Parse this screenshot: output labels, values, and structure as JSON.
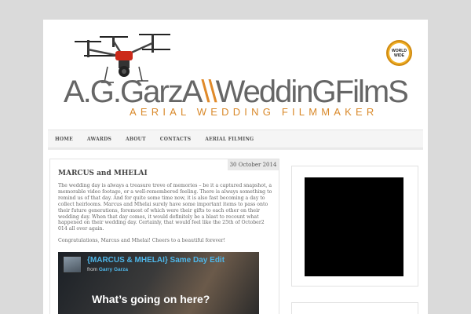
{
  "header": {
    "logo_part1": "A.G.Garz",
    "logo_part2": "A",
    "logo_part3": "\\\\",
    "logo_part4": "WeddinGFilmS",
    "tagline": "AERIAL WEDDING FILMMAKER",
    "badge_line1": "WORLD",
    "badge_line2": "WIDE"
  },
  "nav": {
    "items": [
      {
        "label": "HOME"
      },
      {
        "label": "AWARDS"
      },
      {
        "label": "ABOUT"
      },
      {
        "label": "CONTACTS"
      },
      {
        "label": "AERIAL FILMING"
      }
    ]
  },
  "post": {
    "date": "30 October 2014",
    "title": "MARCUS and MHELAI",
    "paragraph1": "The wedding day is always a treasure trove of memories – be it a captured snapshot, a memorable video footage, or a well-remembered feeling. There is always something to remind us of that day. And for quite some time now, it is also fast becoming a day to collect heirlooms. Marcus and Mhelai surely have some important items to pass onto their future generations, foremost of which were their gifts to each other on their wedding day. When that day comes, it would definitely be a blast to recount what happened on their wedding day. Certainly, that would feel like the 25th of October2 014 all over again.",
    "paragraph2": "Congratulations, Marcus and Mhelai! Cheers to a beautiful forever!",
    "video": {
      "title": "{MARCUS & MHELAI} Same Day Edit",
      "from_label": "from",
      "author": "Garry Garza",
      "message": "What’s going on here?"
    }
  },
  "colors": {
    "accent": "#e08a2a",
    "link": "#4fb6e8",
    "background": "#dadada"
  }
}
